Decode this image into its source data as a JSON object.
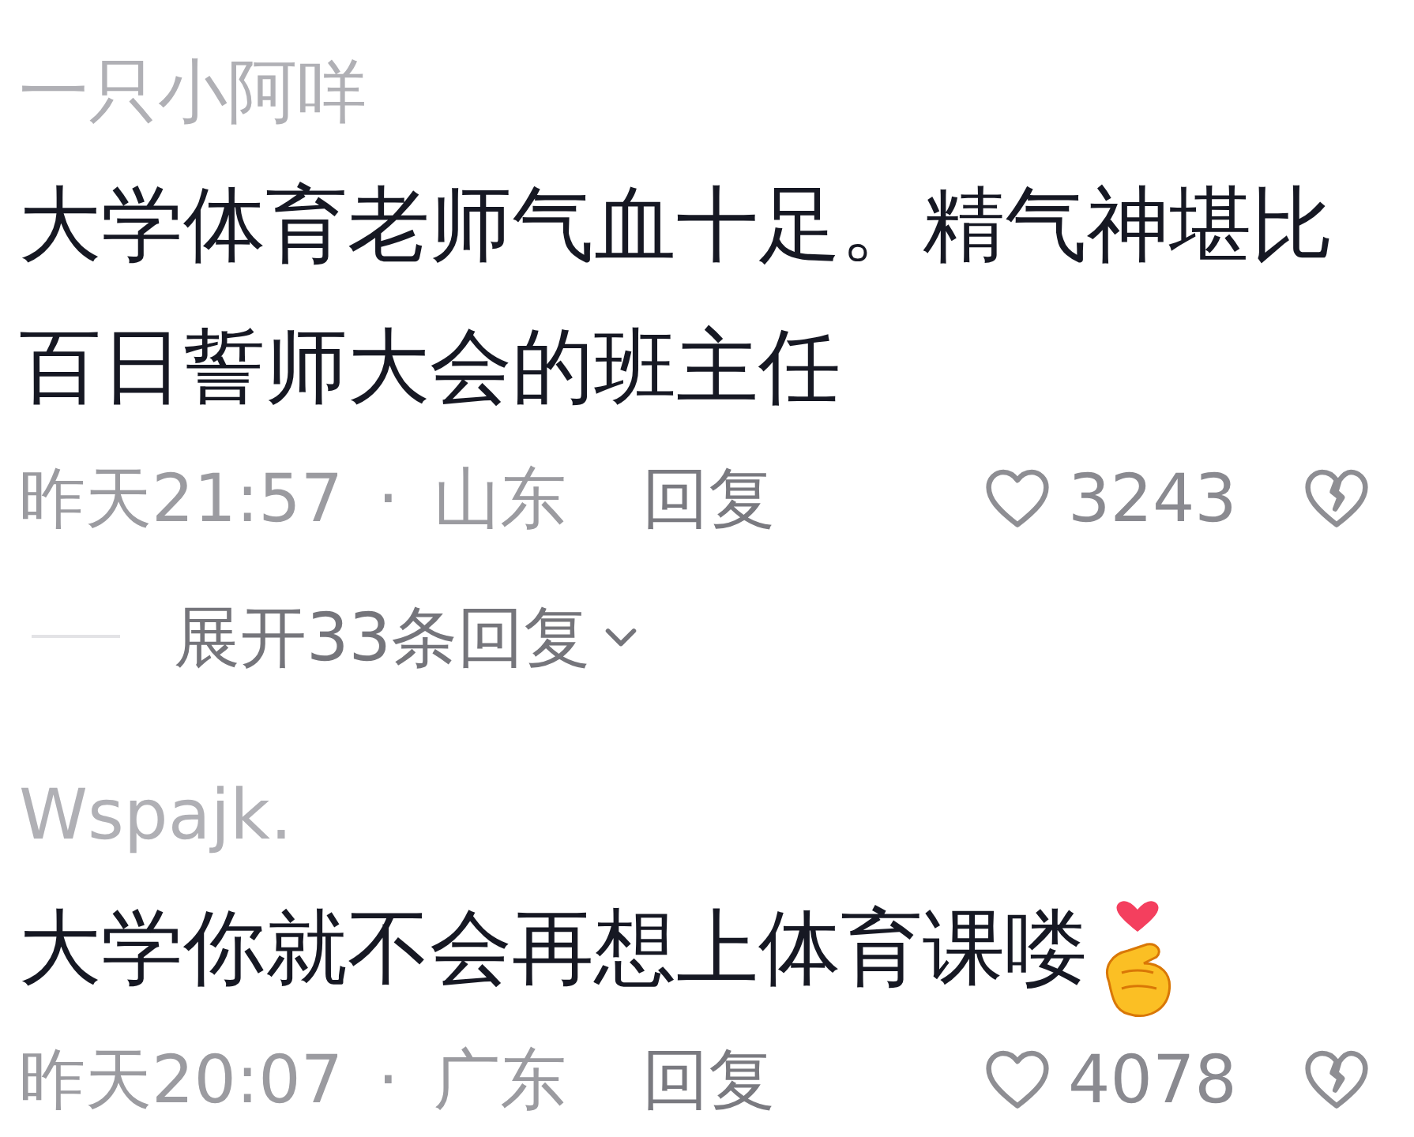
{
  "comments": [
    {
      "username": "一只小阿咩",
      "body": "大学体育老师气血十足。精气神堪比百日誓师大会的班主任",
      "time": "昨天21:57",
      "separator": "·",
      "location": "山东",
      "reply": "回复",
      "likes": "3243",
      "liked": false,
      "replies_toggle": {
        "label": "展开33条回复",
        "expanded": false
      }
    },
    {
      "username": "Wspajk.",
      "body": "大学你就不会再想上体育课喽",
      "has_emoji": true,
      "time": "昨天20:07",
      "separator": "·",
      "location": "广东",
      "reply": "回复",
      "likes": "4078",
      "liked": false
    }
  ]
}
